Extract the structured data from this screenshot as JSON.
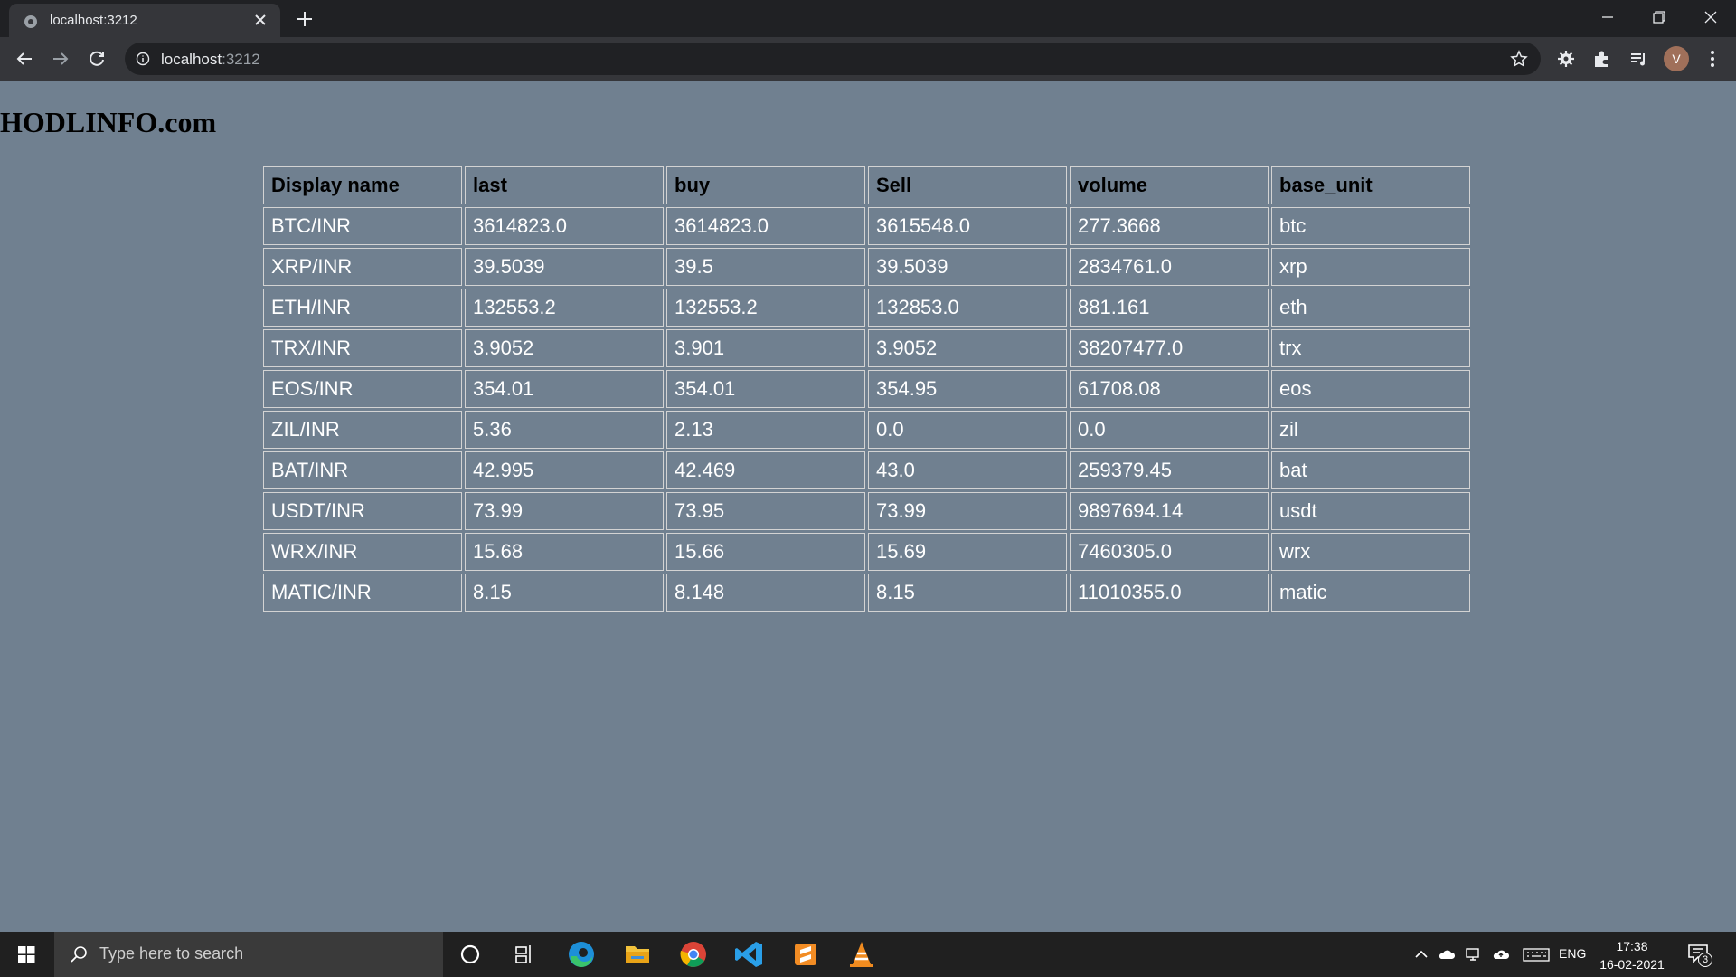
{
  "browser": {
    "tab_title": "localhost:3212",
    "url_host": "localhost",
    "url_port": ":3212",
    "avatar_letter": "V"
  },
  "page": {
    "title": "HODLINFO.com",
    "table": {
      "headers": [
        "Display name",
        "last",
        "buy",
        "Sell",
        "volume",
        "base_unit"
      ],
      "rows": [
        [
          "BTC/INR",
          "3614823.0",
          "3614823.0",
          "3615548.0",
          "277.3668",
          "btc"
        ],
        [
          "XRP/INR",
          "39.5039",
          "39.5",
          "39.5039",
          "2834761.0",
          "xrp"
        ],
        [
          "ETH/INR",
          "132553.2",
          "132553.2",
          "132853.0",
          "881.161",
          "eth"
        ],
        [
          "TRX/INR",
          "3.9052",
          "3.901",
          "3.9052",
          "38207477.0",
          "trx"
        ],
        [
          "EOS/INR",
          "354.01",
          "354.01",
          "354.95",
          "61708.08",
          "eos"
        ],
        [
          "ZIL/INR",
          "5.36",
          "2.13",
          "0.0",
          "0.0",
          "zil"
        ],
        [
          "BAT/INR",
          "42.995",
          "42.469",
          "43.0",
          "259379.45",
          "bat"
        ],
        [
          "USDT/INR",
          "73.99",
          "73.95",
          "73.99",
          "9897694.14",
          "usdt"
        ],
        [
          "WRX/INR",
          "15.68",
          "15.66",
          "15.69",
          "7460305.0",
          "wrx"
        ],
        [
          "MATIC/INR",
          "8.15",
          "8.148",
          "8.15",
          "11010355.0",
          "matic"
        ]
      ]
    }
  },
  "taskbar": {
    "search_placeholder": "Type here to search",
    "language": "ENG",
    "time": "17:38",
    "date": "16-02-2021",
    "notification_count": "3",
    "apps": [
      "cortana-icon",
      "task-view-icon",
      "edge-icon",
      "file-explorer-icon",
      "chrome-icon",
      "vscode-icon",
      "sublime-text-icon",
      "vlc-icon"
    ]
  },
  "colors": {
    "page_background": "#708090",
    "cell_border": "#d3d3d3",
    "cell_text": "#ffffff"
  }
}
